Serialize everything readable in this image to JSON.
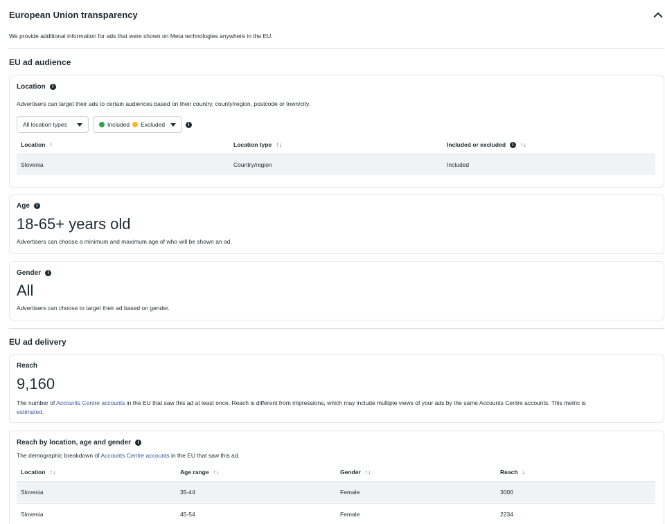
{
  "header": {
    "title": "European Union transparency",
    "intro": "We provide additional information for ads that were shown on Meta technologies anywhere in the EU."
  },
  "audience": {
    "section_title": "EU ad audience",
    "location": {
      "title": "Location",
      "desc": "Advertisers can target their ads to certain audiences based on their country, county/region, postcode or town/city.",
      "filter_label": "All location types",
      "included_label": "Included",
      "excluded_label": "Excluded",
      "columns": [
        "Location",
        "Location type",
        "Included or excluded"
      ],
      "rows": [
        {
          "location": "Slovenia",
          "type": "Country/region",
          "status": "Included"
        }
      ]
    },
    "age": {
      "title": "Age",
      "value": "18-65+ years old",
      "desc": "Advertisers can choose a minimum and maximum age of who will be shown an ad."
    },
    "gender": {
      "title": "Gender",
      "value": "All",
      "desc": "Advertisers can choose to target their ad based on gender."
    }
  },
  "delivery": {
    "section_title": "EU ad delivery",
    "reach": {
      "title": "Reach",
      "value": "9,160",
      "desc_a": "The number of ",
      "link": "Accounts Centre accounts",
      "desc_b": " in the EU that saw this ad at least once. Reach is different from impressions, which may include multiple views of your ads by the same Accounts Centre accounts. This metric is",
      "desc_c": "estimated",
      "desc_d": "."
    },
    "breakdown": {
      "title": "Reach by location, age and gender",
      "desc_a": "The demographic breakdown of ",
      "link": "Accounts Centre accounts",
      "desc_b": " in the EU that saw this ad.",
      "columns": [
        "Location",
        "Age range",
        "Gender",
        "Reach"
      ],
      "rows": [
        {
          "location": "Slovenia",
          "age": "35-44",
          "gender": "Female",
          "reach": "3000"
        },
        {
          "location": "Slovenia",
          "age": "45-54",
          "gender": "Female",
          "reach": "2234"
        }
      ]
    }
  },
  "colors": {
    "included": "#31a24c",
    "excluded": "#f7b928",
    "link": "#385898"
  }
}
